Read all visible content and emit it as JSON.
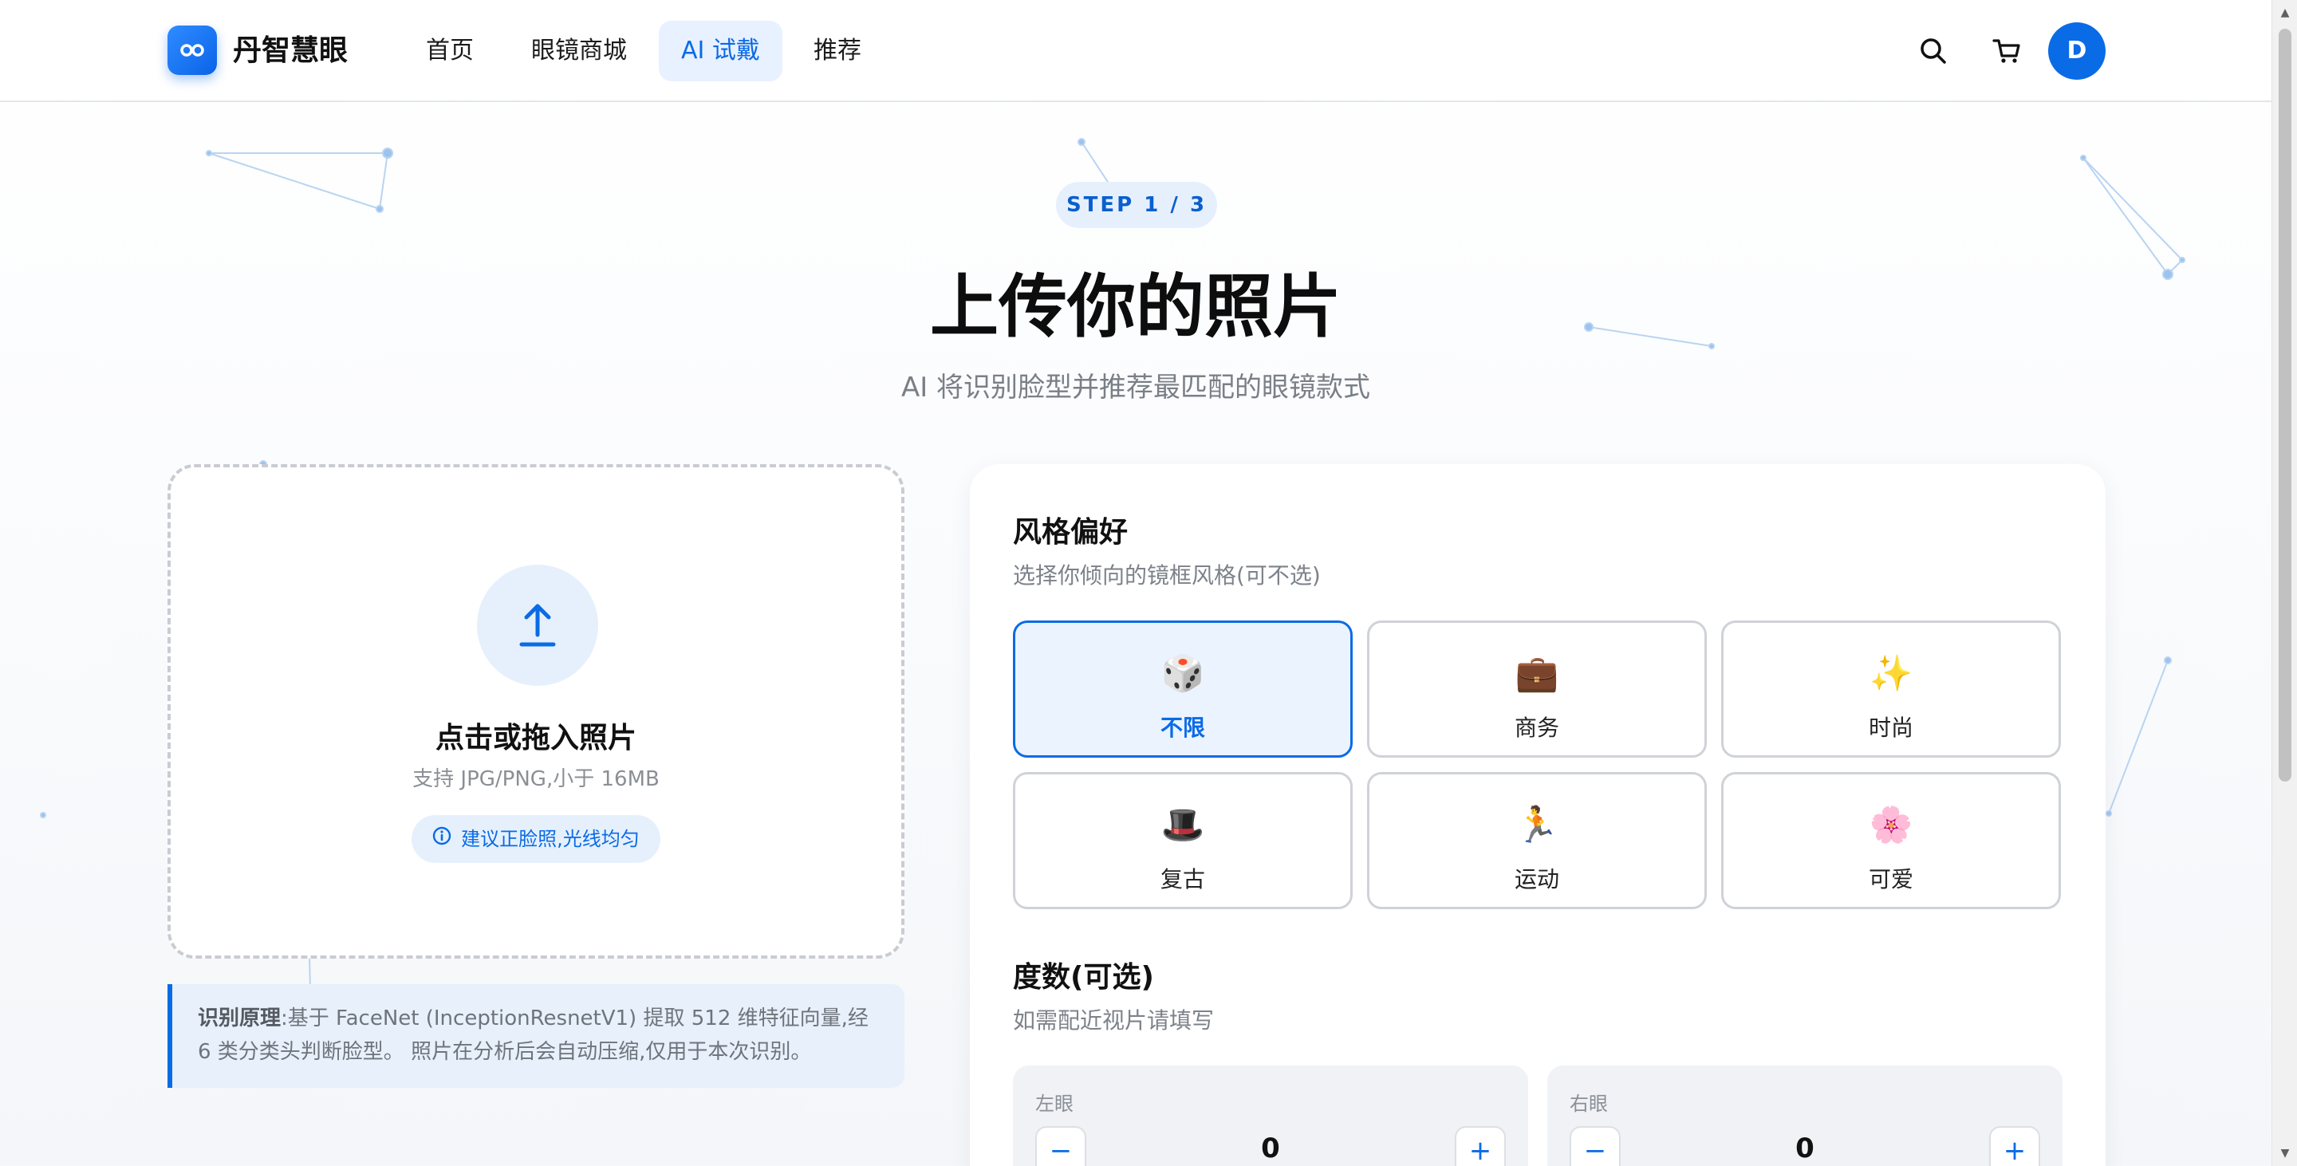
{
  "nav": {
    "brand": "丹智慧眼",
    "items": [
      {
        "label": "首页",
        "active": false
      },
      {
        "label": "眼镜商城",
        "active": false
      },
      {
        "label": "AI 试戴",
        "active": true
      },
      {
        "label": "推荐",
        "active": false
      }
    ],
    "avatar_initial": "D",
    "accent_color": "#0a6be6"
  },
  "hero": {
    "step": "STEP 1 / 3",
    "title": "上传你的照片",
    "subtitle": "AI 将识别脸型并推荐最匹配的眼镜款式"
  },
  "upload": {
    "title": "点击或拖入照片",
    "hint": "支持 JPG/PNG,小于 16MB",
    "tip": "建议正脸照,光线均匀",
    "icon": "upload-arrow-icon"
  },
  "note": {
    "label": "识别原理",
    "text": ":基于 FaceNet (InceptionResnetV1) 提取 512 维特征向量,经 6 类分类头判断脸型。 照片在分析后会自动压缩,仅用于本次识别。"
  },
  "style": {
    "title": "风格偏好",
    "subtitle": "选择你倾向的镜框风格(可不选)",
    "options": [
      {
        "emoji": "🎲",
        "label": "不限",
        "selected": true
      },
      {
        "emoji": "💼",
        "label": "商务",
        "selected": false
      },
      {
        "emoji": "✨",
        "label": "时尚",
        "selected": false
      },
      {
        "emoji": "🎩",
        "label": "复古",
        "selected": false
      },
      {
        "emoji": "🏃",
        "label": "运动",
        "selected": false
      },
      {
        "emoji": "🌸",
        "label": "可爱",
        "selected": false
      }
    ]
  },
  "prescription": {
    "title": "度数(可选)",
    "subtitle": "如需配近视片请填写",
    "left": {
      "label": "左眼",
      "value": "0",
      "minus": "−",
      "plus": "+"
    },
    "right": {
      "label": "右眼",
      "value": "0",
      "minus": "−",
      "plus": "+"
    }
  }
}
